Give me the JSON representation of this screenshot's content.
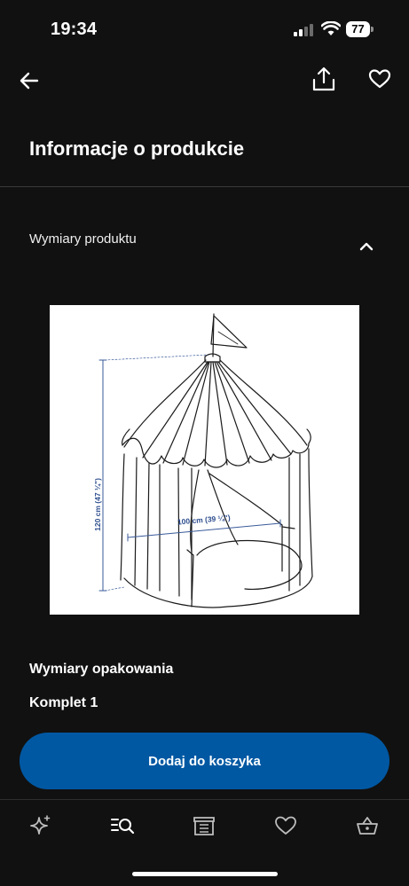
{
  "status": {
    "time": "19:34",
    "battery": "77"
  },
  "icons": {
    "back": "arrow-left-icon",
    "share": "share-icon",
    "favorite": "heart-icon",
    "collapse": "chevron-up-icon"
  },
  "page": {
    "title": "Informacje o produkcie"
  },
  "dimensions": {
    "label": "Wymiary produktu",
    "height_label": "120 cm (47 ¼\")",
    "width_label": "100 cm (39 ¼\")"
  },
  "packaging": {
    "heading": "Wymiary opakowania",
    "set": "Komplet 1"
  },
  "cart": {
    "label": "Dodaj do koszyka"
  },
  "tabbar": {
    "items": [
      "sparkle-icon",
      "search-list-icon",
      "store-icon",
      "heart-icon",
      "basket-icon"
    ]
  },
  "colors": {
    "background": "#111111",
    "accent": "#0058a3",
    "text": "#ffffff"
  }
}
